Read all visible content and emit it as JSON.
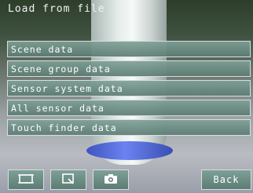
{
  "title": "Load from file",
  "menu": {
    "items": [
      {
        "label": "Scene data"
      },
      {
        "label": "Scene group data"
      },
      {
        "label": "Sensor system data"
      },
      {
        "label": "All sensor data"
      },
      {
        "label": "Touch finder data"
      }
    ]
  },
  "toolbar": {
    "icons": [
      "frame-icon",
      "zoom-window-icon",
      "camera-icon"
    ],
    "back_label": "Back"
  },
  "colors": {
    "button_top": "#7ea096",
    "button_bottom": "#5c7c74",
    "border": "#d9dde0",
    "text": "#ffffff"
  }
}
